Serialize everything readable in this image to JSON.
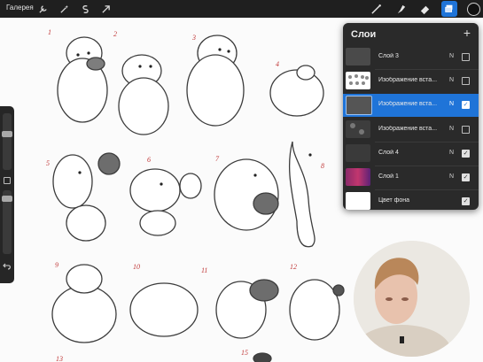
{
  "toolbar": {
    "gallery_label": "Галерея",
    "left_tools": [
      "wrench-icon",
      "magic-wand-icon",
      "selection-icon",
      "transform-arrow-icon"
    ],
    "right_tools": [
      "brush-icon",
      "smudge-icon",
      "eraser-icon",
      "layers-icon",
      "color-swatch"
    ],
    "color": "#111111"
  },
  "canvas": {
    "numbers": [
      "1",
      "2",
      "3",
      "4",
      "5",
      "6",
      "7",
      "8",
      "9",
      "10",
      "11",
      "12",
      "13",
      "15"
    ]
  },
  "layers_panel": {
    "title": "Слои",
    "add_label": "+",
    "layers": [
      {
        "name": "Слой 3",
        "blend": "N",
        "visible": false,
        "active": false
      },
      {
        "name": "Изображение вста...",
        "blend": "N",
        "visible": false,
        "active": false
      },
      {
        "name": "Изображение вста...",
        "blend": "N",
        "visible": true,
        "active": true
      },
      {
        "name": "Изображение вста...",
        "blend": "N",
        "visible": false,
        "active": false
      },
      {
        "name": "Слой 4",
        "blend": "N",
        "visible": true,
        "active": false
      },
      {
        "name": "Слой 1",
        "blend": "N",
        "visible": true,
        "active": false
      },
      {
        "name": "Цвет фона",
        "blend": "",
        "visible": true,
        "active": false
      }
    ]
  }
}
